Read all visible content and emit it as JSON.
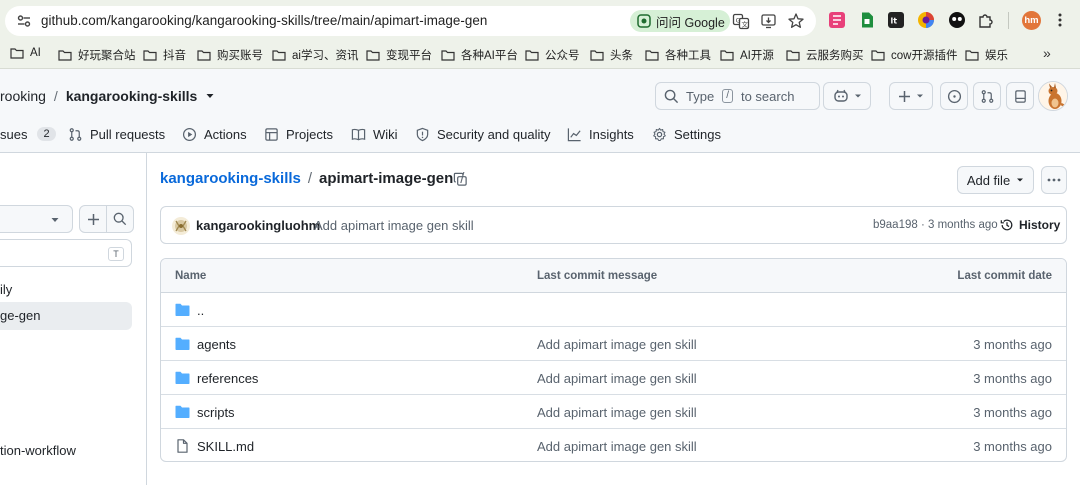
{
  "browser": {
    "url_host": "github.com",
    "url_path": "/kangarooking/kangarooking-skills/tree/main/apimart-image-gen",
    "lens_label": "问问 Google",
    "profile_initials": "hm"
  },
  "bookmarks": [
    {
      "label": "AI"
    },
    {
      "label": "好玩聚合站"
    },
    {
      "label": "抖音"
    },
    {
      "label": "购买账号"
    },
    {
      "label": "ai学习、资讯"
    },
    {
      "label": "变现平台"
    },
    {
      "label": "各种AI平台"
    },
    {
      "label": "公众号"
    },
    {
      "label": "头条"
    },
    {
      "label": "各种工具"
    },
    {
      "label": "AI开源"
    },
    {
      "label": "云服务购买"
    },
    {
      "label": "cow开源插件"
    },
    {
      "label": "娱乐"
    }
  ],
  "bookmarks_more": "»",
  "repo": {
    "owner": "rooking",
    "separator": "/",
    "name": "kangarooking-skills"
  },
  "search": {
    "prefix": "Type",
    "key": "/",
    "suffix": "to search"
  },
  "nav": {
    "issues_label": "sues",
    "issues_count": "2",
    "pull_requests": "Pull requests",
    "actions": "Actions",
    "projects": "Projects",
    "wiki": "Wiki",
    "security": "Security and quality",
    "insights": "Insights",
    "settings": "Settings"
  },
  "sidebar": {
    "filter_key": "T",
    "tree_items": [
      {
        "label": "ily",
        "active": false
      },
      {
        "label": "ge-gen",
        "active": true
      },
      {
        "label": "tion-workflow",
        "active": false
      }
    ]
  },
  "path": {
    "repo_link": "kangarooking-skills",
    "sep1": "/",
    "folder": "apimart-image-gen",
    "sep2": "/"
  },
  "actions": {
    "add_file": "Add file"
  },
  "commit": {
    "author": "kangarookingluohm",
    "message": "Add apimart image gen skill",
    "meta": "b9aa198 · 3 months ago",
    "history_label": "History"
  },
  "table": {
    "headers": {
      "name": "Name",
      "message": "Last commit message",
      "date": "Last commit date"
    },
    "rows": [
      {
        "name": "..",
        "type": "parent",
        "message": "",
        "date": ""
      },
      {
        "name": "agents",
        "type": "folder",
        "message": "Add apimart image gen skill",
        "date": "3 months ago"
      },
      {
        "name": "references",
        "type": "folder",
        "message": "Add apimart image gen skill",
        "date": "3 months ago"
      },
      {
        "name": "scripts",
        "type": "folder",
        "message": "Add apimart image gen skill",
        "date": "3 months ago"
      },
      {
        "name": "SKILL.md",
        "type": "file",
        "message": "Add apimart image gen skill",
        "date": "3 months ago"
      }
    ]
  },
  "colors": {
    "link": "#0969da",
    "folder": "#54aeff",
    "chrome_bg": "#eef2ea",
    "border": "#d0d7de"
  }
}
